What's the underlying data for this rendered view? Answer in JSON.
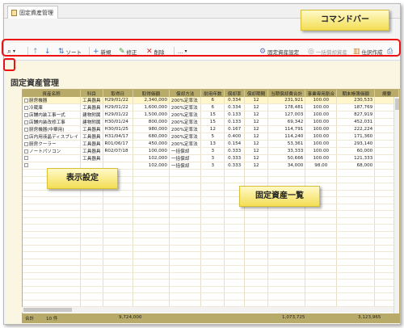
{
  "window": {
    "tab_label": "固定資産管理"
  },
  "toolbar": {
    "sort": "ソート",
    "new": "新規",
    "edit": "修正",
    "delete": "削除",
    "more": "…",
    "asset_setting": "固定資産設定",
    "bulk_depreciation": "一括償却資産",
    "ledger": "仕訳作成"
  },
  "page": {
    "title": "固定資産管理"
  },
  "table": {
    "headers": [
      "資産名称",
      "科目",
      "取得日",
      "取得価額",
      "償却方法",
      "耐用年数",
      "償却率",
      "償却期間",
      "当期償却費合計",
      "事業専用割合",
      "期末帳簿価額",
      "摘要"
    ],
    "rows": [
      [
        "厨房機器",
        "工具器具",
        "H29/01/22",
        "2,340,000",
        "200%定率法",
        "6",
        "0.334",
        "12",
        "231,921",
        "100.00",
        "230,533",
        ""
      ],
      [
        "冷蔵庫",
        "工具器具",
        "H29/01/22",
        "1,600,000",
        "200%定率法",
        "6",
        "0.334",
        "12",
        "178,481",
        "100.00",
        "187,769",
        ""
      ],
      [
        "店舗内装工事一式",
        "建物附属",
        "H29/01/22",
        "1,500,000",
        "200%定率法",
        "15",
        "0.133",
        "12",
        "127,003",
        "100.00",
        "827,919",
        ""
      ],
      [
        "店舗内装改修工事",
        "建物附属",
        "H30/01/24",
        "800,000",
        "200%定率法",
        "15",
        "0.133",
        "12",
        "69,342",
        "100.00",
        "452,031",
        ""
      ],
      [
        "厨房機器(中華用)",
        "工具器具",
        "H30/01/25",
        "980,000",
        "200%定率法",
        "12",
        "0.167",
        "12",
        "114,791",
        "100.00",
        "222,224",
        ""
      ],
      [
        "店内用液晶ディスプレイ",
        "工具器具",
        "H31/04/17",
        "680,000",
        "200%定率法",
        "5",
        "0.400",
        "12",
        "114,240",
        "100.00",
        "171,360",
        ""
      ],
      [
        "厨房クーラー",
        "工具器具",
        "R01/06/17",
        "450,000",
        "200%定率法",
        "13",
        "0.154",
        "12",
        "53,361",
        "100.00",
        "293,140",
        ""
      ],
      [
        "ノートパソコン",
        "工具器具",
        "R02/07/18",
        "100,000",
        "一括償却",
        "3",
        "0.333",
        "12",
        "33,333",
        "100.00",
        "60,000",
        ""
      ],
      [
        "",
        "工具器具",
        "",
        "102,000",
        "一括償却",
        "3",
        "0.333",
        "12",
        "50,666",
        "100.00",
        "121,333",
        ""
      ],
      [
        "",
        "",
        "",
        "102,000",
        "一括償却",
        "3",
        "0.333",
        "12",
        "34,000",
        "98.00",
        "68,000",
        ""
      ]
    ]
  },
  "footer": {
    "label": "合計",
    "count": "10 件",
    "acq_total": "9,724,000",
    "dep_total": "1,073,725",
    "book_total": "3,123,965"
  },
  "callouts": {
    "command_bar": "コマンドバー",
    "display_setting": "表示設定",
    "asset_list": "固定資産一覧"
  }
}
